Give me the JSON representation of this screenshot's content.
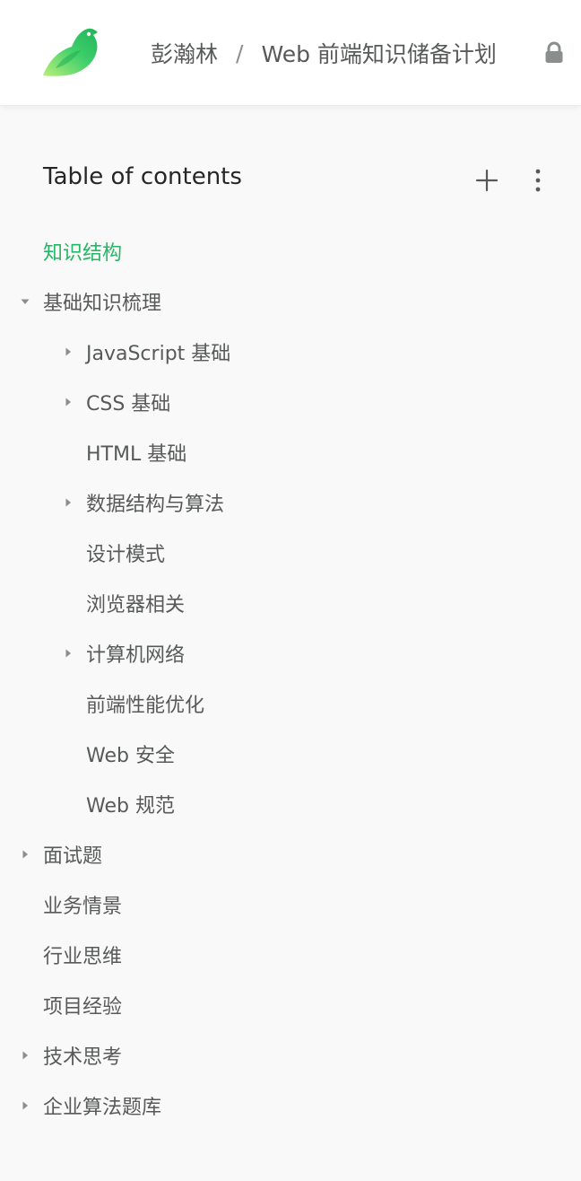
{
  "breadcrumb": {
    "user": "彭瀚林",
    "separator": "/",
    "book": "Web 前端知识储备计划"
  },
  "icons": {
    "logo": "bird-logo-icon",
    "lock": "lock-icon",
    "add": "plus-icon",
    "more": "more-vertical-icon",
    "expanded": "caret-down-icon",
    "collapsed": "caret-right-icon"
  },
  "colors": {
    "accent": "#25b864",
    "text": "#585a5a",
    "title": "#262626",
    "background": "#f9f9f9"
  },
  "toc": {
    "title": "Table of contents",
    "items": [
      {
        "label": "知识结构",
        "level": 0,
        "caret": "none",
        "active": true
      },
      {
        "label": "基础知识梳理",
        "level": 0,
        "caret": "expanded",
        "active": false
      },
      {
        "label": "JavaScript 基础",
        "level": 1,
        "caret": "collapsed",
        "active": false
      },
      {
        "label": "CSS 基础",
        "level": 1,
        "caret": "collapsed",
        "active": false
      },
      {
        "label": "HTML 基础",
        "level": 1,
        "caret": "none",
        "active": false
      },
      {
        "label": "数据结构与算法",
        "level": 1,
        "caret": "collapsed",
        "active": false
      },
      {
        "label": "设计模式",
        "level": 1,
        "caret": "none",
        "active": false
      },
      {
        "label": "浏览器相关",
        "level": 1,
        "caret": "none",
        "active": false
      },
      {
        "label": "计算机网络",
        "level": 1,
        "caret": "collapsed",
        "active": false
      },
      {
        "label": "前端性能优化",
        "level": 1,
        "caret": "none",
        "active": false
      },
      {
        "label": "Web 安全",
        "level": 1,
        "caret": "none",
        "active": false
      },
      {
        "label": "Web 规范",
        "level": 1,
        "caret": "none",
        "active": false
      },
      {
        "label": "面试题",
        "level": 0,
        "caret": "collapsed",
        "active": false
      },
      {
        "label": "业务情景",
        "level": 0,
        "caret": "none",
        "active": false
      },
      {
        "label": "行业思维",
        "level": 0,
        "caret": "none",
        "active": false
      },
      {
        "label": "项目经验",
        "level": 0,
        "caret": "none",
        "active": false
      },
      {
        "label": "技术思考",
        "level": 0,
        "caret": "collapsed",
        "active": false
      },
      {
        "label": "企业算法题库",
        "level": 0,
        "caret": "collapsed",
        "active": false
      }
    ]
  }
}
